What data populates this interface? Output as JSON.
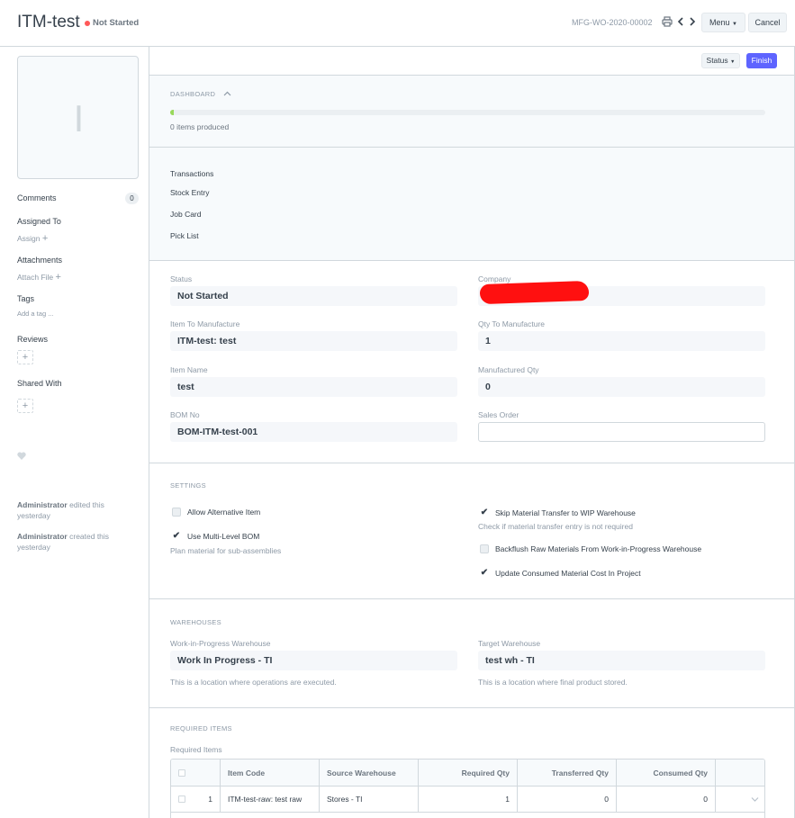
{
  "header": {
    "title": "ITM-test",
    "status": "Not Started",
    "doc_name": "MFG-WO-2020-00002",
    "menu_label": "Menu",
    "cancel_label": "Cancel"
  },
  "sidebar": {
    "image_letter": "I",
    "comments_label": "Comments",
    "comments_count": "0",
    "assigned_label": "Assigned To",
    "assign_link": "Assign",
    "attachments_label": "Attachments",
    "attach_link": "Attach File",
    "tags_label": "Tags",
    "tag_link": "Add a tag ...",
    "reviews_label": "Reviews",
    "shared_label": "Shared With",
    "activity": [
      {
        "user": "Administrator",
        "text": "edited this yesterday"
      },
      {
        "user": "Administrator",
        "text": "created this yesterday"
      }
    ]
  },
  "toolbar": {
    "status_label": "Status",
    "finish_label": "Finish"
  },
  "dashboard": {
    "heading": "DASHBOARD",
    "progress_fraction": 0.005,
    "produced_text": "0 items produced",
    "transactions_heading": "Transactions",
    "transactions": [
      "Stock Entry",
      "Job Card",
      "Pick List"
    ]
  },
  "fields": {
    "status_label": "Status",
    "status_value": "Not Started",
    "company_label": "Company",
    "company_value": "",
    "item_label": "Item To Manufacture",
    "item_value": "ITM-test: test",
    "qty_label": "Qty To Manufacture",
    "qty_value": "1",
    "item_name_label": "Item Name",
    "item_name_value": "test",
    "manufactured_label": "Manufactured Qty",
    "manufactured_value": "0",
    "bom_label": "BOM No",
    "bom_value": "BOM-ITM-test-001",
    "sales_order_label": "Sales Order",
    "sales_order_value": ""
  },
  "settings": {
    "heading": "SETTINGS",
    "allow_alt": {
      "label": "Allow Alternative Item",
      "checked": false
    },
    "multi_level": {
      "label": "Use Multi-Level BOM",
      "checked": true
    },
    "multi_level_help": "Plan material for sub-assemblies",
    "skip_transfer": {
      "label": "Skip Material Transfer to WIP Warehouse",
      "checked": true
    },
    "skip_transfer_help": "Check if material transfer entry is not required",
    "backflush": {
      "label": "Backflush Raw Materials From Work-in-Progress Warehouse",
      "checked": false
    },
    "update_cost": {
      "label": "Update Consumed Material Cost In Project",
      "checked": true
    }
  },
  "warehouses": {
    "heading": "WAREHOUSES",
    "wip_label": "Work-in-Progress Warehouse",
    "wip_value": "Work In Progress - TI",
    "wip_help": "This is a location where operations are executed.",
    "target_label": "Target Warehouse",
    "target_value": "test wh - TI",
    "target_help": "This is a location where final product stored."
  },
  "required_items": {
    "heading": "REQUIRED ITEMS",
    "table_label": "Required Items",
    "columns": [
      "Item Code",
      "Source Warehouse",
      "Required Qty",
      "Transferred Qty",
      "Consumed Qty"
    ],
    "rows": [
      {
        "idx": "1",
        "item_code": "ITM-test-raw: test raw",
        "source_warehouse": "Stores - TI",
        "required_qty": "1",
        "transferred_qty": "0",
        "consumed_qty": "0"
      }
    ]
  }
}
